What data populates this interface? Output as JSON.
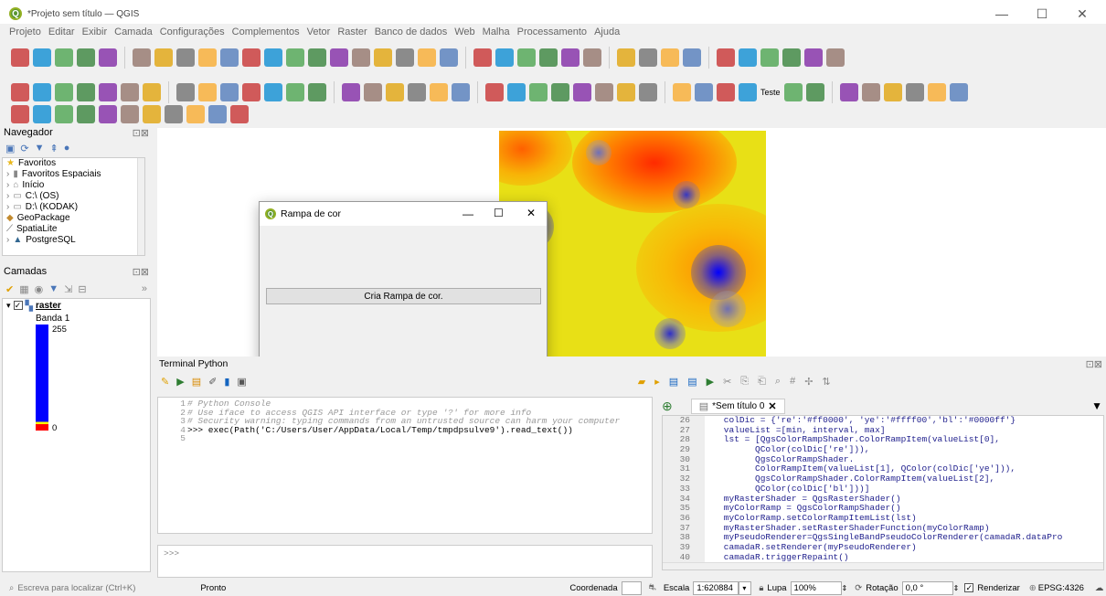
{
  "window": {
    "title": "*Projeto sem título — QGIS",
    "minimize": "—",
    "maximize": "☐",
    "close": "✕"
  },
  "menu": [
    "Projeto",
    "Editar",
    "Exibir",
    "Camada",
    "Configurações",
    "Complementos",
    "Vetor",
    "Raster",
    "Banco de dados",
    "Web",
    "Malha",
    "Processamento",
    "Ajuda"
  ],
  "toolbar": {
    "teste_label": "Teste"
  },
  "navigator": {
    "title": "Navegador",
    "items": [
      "Favoritos",
      "Favoritos Espaciais",
      "Início",
      "C:\\ (OS)",
      "D:\\ (KODAK)",
      "GeoPackage",
      "SpatiaLite",
      "PostgreSQL"
    ]
  },
  "layers": {
    "title": "Camadas",
    "layer_name": "raster",
    "band": "Banda 1",
    "max": "255",
    "min": "0"
  },
  "dialog": {
    "title": "Rampa de cor",
    "button": "Cria Rampa de cor.",
    "minimize": "—",
    "maximize": "☐",
    "close": "✕"
  },
  "python": {
    "title": "Terminal Python",
    "console_lines": [
      {
        "n": "1",
        "t": "# Python Console"
      },
      {
        "n": "2",
        "t": "# Use iface to access QGIS API interface or type '?' for more info"
      },
      {
        "n": "3",
        "t": "# Security warning: typing commands from an untrusted source can harm your computer"
      },
      {
        "n": "4",
        "t": ">>> exec(Path('C:/Users/User/AppData/Local/Temp/tmpdpsulve9').read_text())"
      },
      {
        "n": "5",
        "t": ""
      }
    ],
    "prompt": ">>>",
    "editor_tab": "*Sem título 0",
    "editor_lines": [
      {
        "n": "26",
        "t": "    colDic = {'re':'#ff0000', 'ye':'#ffff00','bl':'#0000ff'}"
      },
      {
        "n": "27",
        "t": "    valueList =[min, interval, max]"
      },
      {
        "n": "28",
        "t": "    lst = [QgsColorRampShader.ColorRampItem(valueList[0],"
      },
      {
        "n": "29",
        "t": "          QColor(colDic['re'])),"
      },
      {
        "n": "30",
        "t": "          QgsColorRampShader."
      },
      {
        "n": "31",
        "t": "          ColorRampItem(valueList[1], QColor(colDic['ye'])),"
      },
      {
        "n": "32",
        "t": "          QgsColorRampShader.ColorRampItem(valueList[2],"
      },
      {
        "n": "33",
        "t": "          QColor(colDic['bl']))]"
      },
      {
        "n": "34",
        "t": "    myRasterShader = QgsRasterShader()"
      },
      {
        "n": "35",
        "t": "    myColorRamp = QgsColorRampShader()"
      },
      {
        "n": "36",
        "t": "    myColorRamp.setColorRampItemList(lst)"
      },
      {
        "n": "37",
        "t": "    myRasterShader.setRasterShaderFunction(myColorRamp)"
      },
      {
        "n": "38",
        "t": "    myPseudoRenderer=QgsSingleBandPseudoColorRenderer(camadaR.dataPro"
      },
      {
        "n": "39",
        "t": "    camadaR.setRenderer(myPseudoRenderer)"
      },
      {
        "n": "40",
        "t": "    camadaR.triggerRepaint()"
      }
    ]
  },
  "status": {
    "search_placeholder": "Escreva para localizar (Ctrl+K)",
    "ready": "Pronto",
    "coord_label": "Coordenada",
    "coord_value": "",
    "scale_label": "Escala",
    "scale_value": "1:620884",
    "zoom_label": "Lupa",
    "zoom_value": "100%",
    "rotation_label": "Rotação",
    "rotation_value": "0,0 °",
    "render_label": "Renderizar",
    "crs": "EPSG:4326"
  },
  "colors": {
    "qgis_green": "#589632",
    "ramp_blue": "#0000ff",
    "ramp_red": "#ff0000",
    "ramp_yellow": "#ffff00"
  }
}
